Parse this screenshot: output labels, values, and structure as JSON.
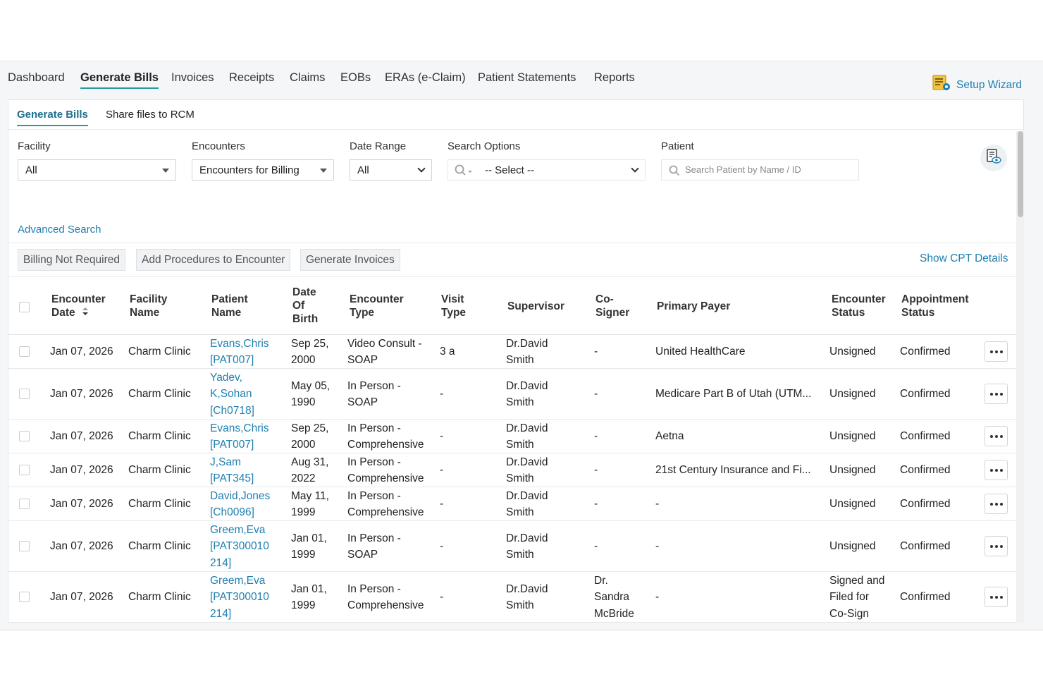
{
  "nav": {
    "items": [
      {
        "label": "Dashboard"
      },
      {
        "label": "Generate Bills"
      },
      {
        "label": "Invoices"
      },
      {
        "label": "Receipts"
      },
      {
        "label": "Claims"
      },
      {
        "label": "EOBs"
      },
      {
        "label": "ERAs (e-Claim)"
      },
      {
        "label": "Patient Statements"
      },
      {
        "label": "Reports"
      }
    ],
    "active": "Generate Bills",
    "setup_wizard": "Setup Wizard"
  },
  "subtabs": [
    {
      "label": "Generate Bills"
    },
    {
      "label": "Share files to RCM"
    }
  ],
  "filters": {
    "facility": {
      "label": "Facility",
      "value": "All"
    },
    "encounters": {
      "label": "Encounters",
      "value": "Encounters for Billing"
    },
    "date_range": {
      "label": "Date Range",
      "value": "All"
    },
    "search_options": {
      "label": "Search Options",
      "value": "-- Select --"
    },
    "patient": {
      "label": "Patient",
      "placeholder": "Search Patient by Name / ID"
    }
  },
  "advanced_search": "Advanced Search",
  "actions": {
    "billing_not_required": "Billing Not Required",
    "add_procedures": "Add Procedures to Encounter",
    "generate_invoices": "Generate Invoices",
    "show_cpt": "Show CPT Details"
  },
  "table": {
    "headers": {
      "encounter_date": [
        "Encounter",
        "Date"
      ],
      "facility_name": [
        "Facility",
        "Name"
      ],
      "patient_name": [
        "Patient",
        "Name"
      ],
      "dob": [
        "Date",
        "Of",
        "Birth"
      ],
      "encounter_type": [
        "Encounter",
        "Type"
      ],
      "visit_type": [
        "Visit",
        "Type"
      ],
      "supervisor": [
        "Supervisor"
      ],
      "co_signer": [
        "Co-",
        "Signer"
      ],
      "primary_payer": [
        "Primary Payer"
      ],
      "encounter_status": [
        "Encounter",
        "Status"
      ],
      "appointment_status": [
        "Appointment",
        "Status"
      ]
    },
    "rows": [
      {
        "date": "Jan 07, 2026",
        "facility": "Charm Clinic",
        "patient": [
          "Evans,Chris",
          "[PAT007]"
        ],
        "dob": [
          "Sep 25,",
          "2000"
        ],
        "enc_type": [
          "Video Consult -",
          "SOAP"
        ],
        "visit": "3 a",
        "supervisor": [
          "Dr.David",
          "Smith"
        ],
        "cosigner": [
          "-"
        ],
        "payer": "United HealthCare",
        "enc_status": [
          "Unsigned"
        ],
        "appt_status": "Confirmed"
      },
      {
        "date": "Jan 07, 2026",
        "facility": "Charm Clinic",
        "patient": [
          "Yadev,",
          "K,Sohan",
          "[Ch0718]"
        ],
        "dob": [
          "May 05,",
          "1990"
        ],
        "enc_type": [
          "In Person -",
          "SOAP"
        ],
        "visit": "-",
        "supervisor": [
          "Dr.David",
          "Smith"
        ],
        "cosigner": [
          "-"
        ],
        "payer": "Medicare Part B of Utah (UTM...",
        "enc_status": [
          "Unsigned"
        ],
        "appt_status": "Confirmed"
      },
      {
        "date": "Jan 07, 2026",
        "facility": "Charm Clinic",
        "patient": [
          "Evans,Chris",
          "[PAT007]"
        ],
        "dob": [
          "Sep 25,",
          "2000"
        ],
        "enc_type": [
          "In Person -",
          "Comprehensive"
        ],
        "visit": "-",
        "supervisor": [
          "Dr.David",
          "Smith"
        ],
        "cosigner": [
          "-"
        ],
        "payer": "Aetna",
        "enc_status": [
          "Unsigned"
        ],
        "appt_status": "Confirmed"
      },
      {
        "date": "Jan 07, 2026",
        "facility": "Charm Clinic",
        "patient": [
          "J,Sam",
          "[PAT345]"
        ],
        "dob": [
          "Aug 31,",
          "2022"
        ],
        "enc_type": [
          "In Person -",
          "Comprehensive"
        ],
        "visit": "-",
        "supervisor": [
          "Dr.David",
          "Smith"
        ],
        "cosigner": [
          "-"
        ],
        "payer": "21st Century Insurance and Fi...",
        "enc_status": [
          "Unsigned"
        ],
        "appt_status": "Confirmed"
      },
      {
        "date": "Jan 07, 2026",
        "facility": "Charm Clinic",
        "patient": [
          "David,Jones",
          "[Ch0096]"
        ],
        "dob": [
          "May 11,",
          "1999"
        ],
        "enc_type": [
          "In Person -",
          "Comprehensive"
        ],
        "visit": "-",
        "supervisor": [
          "Dr.David",
          "Smith"
        ],
        "cosigner": [
          "-"
        ],
        "payer": "-",
        "enc_status": [
          "Unsigned"
        ],
        "appt_status": "Confirmed"
      },
      {
        "date": "Jan 07, 2026",
        "facility": "Charm Clinic",
        "patient": [
          "Greem,Eva",
          "[PAT300010",
          "214]"
        ],
        "dob": [
          "Jan 01,",
          "1999"
        ],
        "enc_type": [
          "In Person -",
          "SOAP"
        ],
        "visit": "-",
        "supervisor": [
          "Dr.David",
          "Smith"
        ],
        "cosigner": [
          "-"
        ],
        "payer": "-",
        "enc_status": [
          "Unsigned"
        ],
        "appt_status": "Confirmed"
      },
      {
        "date": "Jan 07, 2026",
        "facility": "Charm Clinic",
        "patient": [
          "Greem,Eva",
          "[PAT300010",
          "214]"
        ],
        "dob": [
          "Jan 01,",
          "1999"
        ],
        "enc_type": [
          "In Person -",
          "Comprehensive"
        ],
        "visit": "-",
        "supervisor": [
          "Dr.David",
          "Smith"
        ],
        "cosigner": [
          "Dr.",
          "Sandra",
          "McBride"
        ],
        "payer": "-",
        "enc_status": [
          "Signed and",
          "Filed for",
          "Co-Sign"
        ],
        "appt_status": "Confirmed"
      }
    ]
  }
}
